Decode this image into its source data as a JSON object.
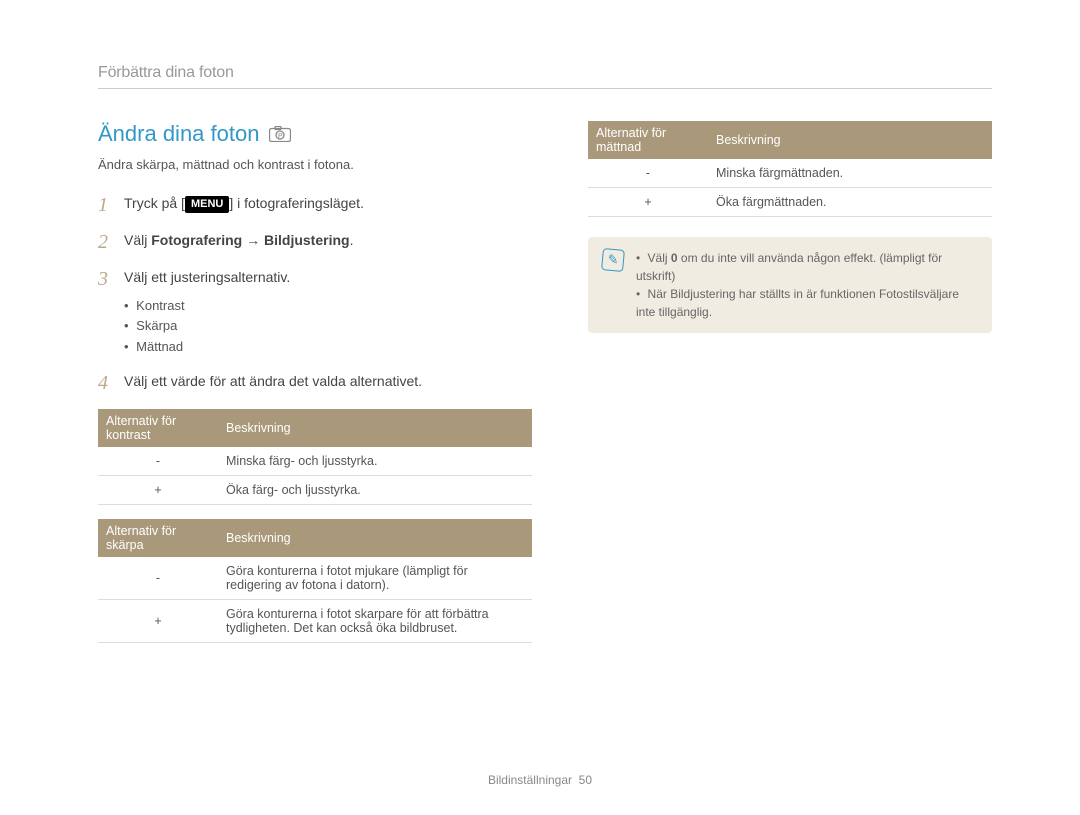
{
  "header": {
    "breadcrumb": "Förbättra dina foton"
  },
  "section": {
    "title": "Ändra dina foton",
    "intro": "Ändra skärpa, mättnad och kontrast i fotona."
  },
  "steps": {
    "s1": {
      "num": "1",
      "pre": "Tryck på [",
      "menu": "MENU",
      "post": "] i fotograferingsläget."
    },
    "s2": {
      "num": "2",
      "pre": "Välj ",
      "bold": "Fotografering → Bildjustering",
      "post": "."
    },
    "s3": {
      "num": "3",
      "text": "Välj ett justeringsalternativ.",
      "bullets": {
        "b1": "Kontrast",
        "b2": "Skärpa",
        "b3": "Mättnad"
      }
    },
    "s4": {
      "num": "4",
      "text": "Välj ett värde för att ändra det valda alternativet."
    }
  },
  "table_kontrast": {
    "h1": "Alternativ för kontrast",
    "h2": "Beskrivning",
    "r1": {
      "opt": "-",
      "desc": "Minska färg- och ljusstyrka."
    },
    "r2": {
      "opt": "+",
      "desc": "Öka färg- och ljusstyrka."
    }
  },
  "table_skarpa": {
    "h1": "Alternativ för skärpa",
    "h2": "Beskrivning",
    "r1": {
      "opt": "-",
      "desc": "Göra konturerna i fotot mjukare (lämpligt för redigering av fotona i datorn)."
    },
    "r2": {
      "opt": "+",
      "desc": "Göra konturerna i fotot skarpare för att förbättra tydligheten. Det kan också öka bildbruset."
    }
  },
  "table_mattnad": {
    "h1": "Alternativ för mättnad",
    "h2": "Beskrivning",
    "r1": {
      "opt": "-",
      "desc": "Minska färgmättnaden."
    },
    "r2": {
      "opt": "+",
      "desc": "Öka färgmättnaden."
    }
  },
  "note": {
    "n1_pre": "Välj ",
    "n1_bold": "0",
    "n1_post": " om du inte vill använda någon effekt. (lämpligt för utskrift)",
    "n2": "När Bildjustering har ställts in är funktionen Fotostilsväljare inte tillgänglig."
  },
  "footer": {
    "label": "Bildinställningar",
    "page": "50"
  }
}
